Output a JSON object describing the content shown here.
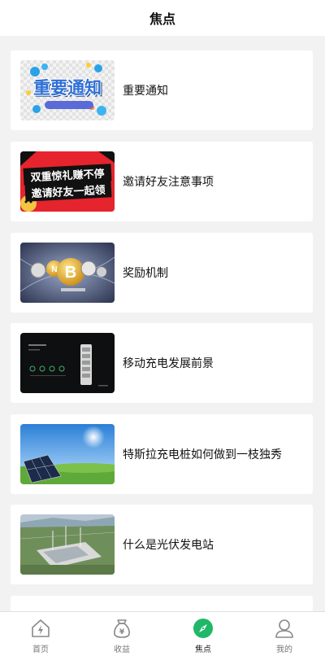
{
  "header": {
    "title": "焦点"
  },
  "articles": [
    {
      "title": "重要通知",
      "thumb_text": "重要通知"
    },
    {
      "title": "邀请好友注意事项",
      "thumb_text_line1": "双重惊礼赚不停",
      "thumb_text_line2": "邀请好友一起领"
    },
    {
      "title": "奖励机制"
    },
    {
      "title": "移动充电发展前景"
    },
    {
      "title": "特斯拉充电桩如何做到一枝独秀"
    },
    {
      "title": "什么是光伏发电站"
    }
  ],
  "tabbar": {
    "items": [
      {
        "label": "首页",
        "icon": "home-lightning-icon"
      },
      {
        "label": "收益",
        "icon": "yen-bag-icon"
      },
      {
        "label": "焦点",
        "icon": "compass-icon",
        "active": true
      },
      {
        "label": "我的",
        "icon": "user-icon"
      }
    ]
  },
  "colors": {
    "active_tab": "#1fb868",
    "inactive_icon": "#888888"
  }
}
